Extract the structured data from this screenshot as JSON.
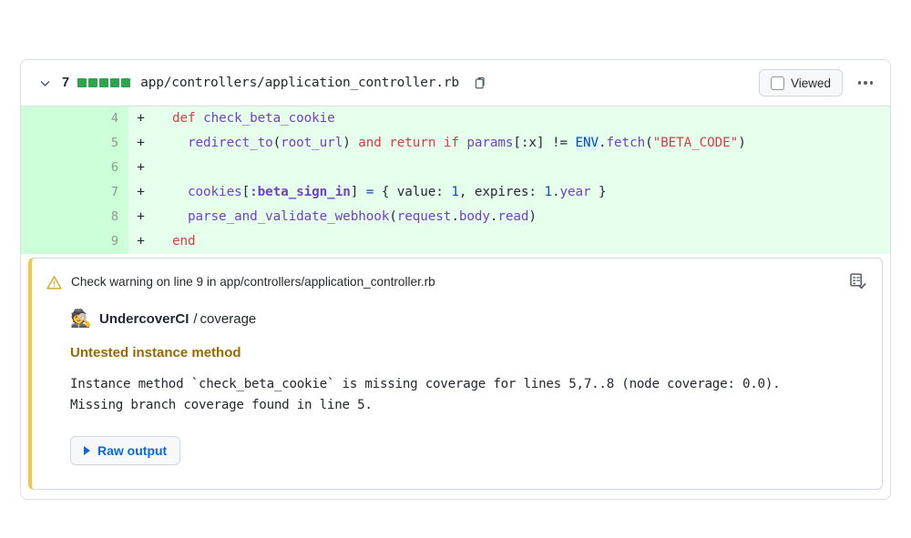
{
  "file_header": {
    "collapse_icon": "chevron-down-icon",
    "change_count": "7",
    "diffstat_blocks": [
      "added",
      "added",
      "added",
      "added",
      "added"
    ],
    "file_path": "app/controllers/application_controller.rb",
    "copy_icon": "clipboard-copy-icon",
    "viewed_label": "Viewed",
    "viewed_checked": false,
    "kebab_label": "more-options"
  },
  "diff": {
    "rows": [
      {
        "line_number": "4",
        "marker": "+",
        "tokens": [
          {
            "text": "  ",
            "type": "plain"
          },
          {
            "text": "def",
            "type": "kw"
          },
          {
            "text": " ",
            "type": "plain"
          },
          {
            "text": "check_beta_cookie",
            "type": "fn"
          }
        ]
      },
      {
        "line_number": "5",
        "marker": "+",
        "tokens": [
          {
            "text": "    ",
            "type": "plain"
          },
          {
            "text": "redirect_to",
            "type": "var"
          },
          {
            "text": "(",
            "type": "op"
          },
          {
            "text": "root_url",
            "type": "var"
          },
          {
            "text": ")",
            "type": "op"
          },
          {
            "text": " ",
            "type": "plain"
          },
          {
            "text": "and",
            "type": "kw"
          },
          {
            "text": " ",
            "type": "plain"
          },
          {
            "text": "return",
            "type": "kw"
          },
          {
            "text": " ",
            "type": "plain"
          },
          {
            "text": "if",
            "type": "kw"
          },
          {
            "text": " ",
            "type": "plain"
          },
          {
            "text": "params",
            "type": "var"
          },
          {
            "text": "[:x] ",
            "type": "op"
          },
          {
            "text": "!=",
            "type": "op"
          },
          {
            "text": " ",
            "type": "plain"
          },
          {
            "text": "ENV",
            "type": "const"
          },
          {
            "text": ".",
            "type": "op"
          },
          {
            "text": "fetch",
            "type": "var"
          },
          {
            "text": "(",
            "type": "op"
          },
          {
            "text": "\"BETA_CODE\"",
            "type": "kw"
          },
          {
            "text": ")",
            "type": "op"
          }
        ]
      },
      {
        "line_number": "6",
        "marker": "+",
        "tokens": []
      },
      {
        "line_number": "7",
        "marker": "+",
        "tokens": [
          {
            "text": "    ",
            "type": "plain"
          },
          {
            "text": "cookies",
            "type": "var"
          },
          {
            "text": "[",
            "type": "op"
          },
          {
            "text": ":beta_sign_in",
            "type": "sym"
          },
          {
            "text": "] ",
            "type": "op"
          },
          {
            "text": "=",
            "type": "num"
          },
          {
            "text": " { value: ",
            "type": "plain"
          },
          {
            "text": "1",
            "type": "num"
          },
          {
            "text": ", expires: ",
            "type": "plain"
          },
          {
            "text": "1",
            "type": "num"
          },
          {
            "text": ".",
            "type": "op"
          },
          {
            "text": "year",
            "type": "var"
          },
          {
            "text": " }",
            "type": "plain"
          }
        ]
      },
      {
        "line_number": "8",
        "marker": "+",
        "tokens": [
          {
            "text": "    ",
            "type": "plain"
          },
          {
            "text": "parse_and_validate_webhook",
            "type": "var"
          },
          {
            "text": "(",
            "type": "op"
          },
          {
            "text": "request",
            "type": "var"
          },
          {
            "text": ".",
            "type": "op"
          },
          {
            "text": "body",
            "type": "var"
          },
          {
            "text": ".",
            "type": "op"
          },
          {
            "text": "read",
            "type": "var"
          },
          {
            "text": ")",
            "type": "op"
          }
        ]
      },
      {
        "line_number": "9",
        "marker": "+",
        "tokens": [
          {
            "text": "  ",
            "type": "plain"
          },
          {
            "text": "end",
            "type": "kw"
          }
        ]
      }
    ]
  },
  "annotation": {
    "warning_icon": "warning-triangle-icon",
    "header_text": "Check warning on line 9 in app/controllers/application_controller.rb",
    "report_icon": "checklist-report-icon",
    "ci_avatar": "🕵️",
    "ci_name": "UndercoverCI",
    "ci_separator": "/",
    "ci_check": "coverage",
    "title": "Untested instance method",
    "message": "Instance method `check_beta_cookie` is missing coverage for lines 5,7..8 (node coverage: 0.0).\nMissing branch coverage found in line 5.",
    "raw_output_label": "Raw output",
    "raw_output_icon": "disclosure-triangle-icon"
  },
  "colors": {
    "addition_bg": "#e6ffec",
    "addition_gutter": "#ccffd8",
    "diffstat_green": "#2da44e",
    "warning_border": "#f2c744",
    "warning_title": "#9a6700",
    "link_blue": "#0969da",
    "card_border": "#d8dee4"
  }
}
